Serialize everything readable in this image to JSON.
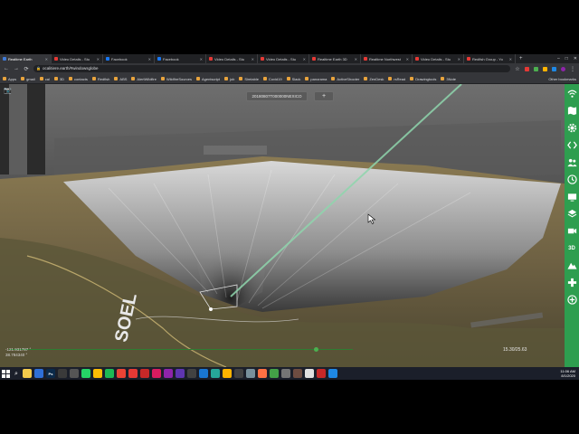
{
  "browser": {
    "tabs": [
      {
        "label": "Realtime Earth",
        "color": "#3f7ad6",
        "active": true
      },
      {
        "label": "Video Details - Stu",
        "color": "#e53935"
      },
      {
        "label": "Facebook",
        "color": "#1877f2"
      },
      {
        "label": "Facebook",
        "color": "#1877f2"
      },
      {
        "label": "Video Details - Stu",
        "color": "#e53935"
      },
      {
        "label": "Video Details - Stu",
        "color": "#e53935"
      },
      {
        "label": "Realtime Earth 3D",
        "color": "#e53935"
      },
      {
        "label": "Realtime Northwest",
        "color": "#e53935"
      },
      {
        "label": "Video Details - Stu",
        "color": "#e53935"
      },
      {
        "label": "Redfish Group - Yo",
        "color": "#e53935"
      }
    ],
    "new_tab_label": "+",
    "url": "ocalitiere.earth/#windowsglobe",
    "bookmarks": [
      "Apps",
      "gmail",
      "cal",
      "3D",
      "contacts",
      "Redfish",
      "ABS",
      "AlertWildfire",
      "WildfireSources",
      "Agentscript",
      "job",
      "Simtable",
      "Covid19",
      "Slack",
      "panorama",
      "ActiveShooter",
      "ZenDesk",
      "rsRead",
      "Drawingtools",
      "3Note"
    ],
    "other_bookmarks": "Other bookmarks"
  },
  "viewer": {
    "time_label": "20180807T000000NEXICO",
    "add_label": "+",
    "coords": {
      "lat": "-121.931787 °",
      "lon": "38.784340 °"
    },
    "view_readout": "15.30/25.63",
    "road_label": "SOEL"
  },
  "toolbar": {
    "items": [
      "wifi-icon",
      "map-icon",
      "gear-icon",
      "code-icon",
      "users-icon",
      "clock-icon",
      "tv-icon",
      "layers-icon",
      "video-icon",
      "3d-icon",
      "mountain-icon",
      "gamepad-icon",
      "plus-circle-icon"
    ],
    "label_3d": "3D",
    "color": "#2e9e4f"
  },
  "taskbar": {
    "apps": [
      {
        "name": "file-explorer-icon",
        "color": "#f2c94c",
        "glyph": ""
      },
      {
        "name": "mail-icon",
        "color": "#2f6fd6",
        "glyph": ""
      },
      {
        "name": "photoshop-icon",
        "color": "#0b2a4a",
        "glyph": "Ps"
      },
      {
        "name": "files-icon",
        "color": "#3a3a3a",
        "glyph": ""
      },
      {
        "name": "settings-icon",
        "color": "#555",
        "glyph": ""
      },
      {
        "name": "whatsapp-icon",
        "color": "#25d366",
        "glyph": ""
      },
      {
        "name": "chrome-icon",
        "color": "#fbbc05",
        "glyph": ""
      },
      {
        "name": "spotify-icon",
        "color": "#1db954",
        "glyph": ""
      },
      {
        "name": "chrome-icon-2",
        "color": "#ea4335",
        "glyph": ""
      },
      {
        "name": "youtube-icon",
        "color": "#e53935",
        "glyph": ""
      },
      {
        "name": "app-icon-1",
        "color": "#c62828",
        "glyph": ""
      },
      {
        "name": "app-icon-2",
        "color": "#d81b60",
        "glyph": ""
      },
      {
        "name": "app-icon-3",
        "color": "#8e24aa",
        "glyph": ""
      },
      {
        "name": "app-icon-4",
        "color": "#5e35b1",
        "glyph": ""
      },
      {
        "name": "app-icon-5",
        "color": "#424242",
        "glyph": ""
      },
      {
        "name": "vscode-icon",
        "color": "#1976d2",
        "glyph": ""
      },
      {
        "name": "app-icon-6",
        "color": "#26a69a",
        "glyph": ""
      },
      {
        "name": "app-icon-7",
        "color": "#ffb300",
        "glyph": ""
      },
      {
        "name": "app-icon-8",
        "color": "#424242",
        "glyph": ""
      },
      {
        "name": "app-icon-9",
        "color": "#78909c",
        "glyph": ""
      },
      {
        "name": "firefox-icon",
        "color": "#ff7043",
        "glyph": ""
      },
      {
        "name": "app-icon-10",
        "color": "#43a047",
        "glyph": ""
      },
      {
        "name": "app-icon-11",
        "color": "#757575",
        "glyph": ""
      },
      {
        "name": "app-icon-12",
        "color": "#6d4c41",
        "glyph": ""
      },
      {
        "name": "app-icon-13",
        "color": "#e0e0e0",
        "glyph": ""
      },
      {
        "name": "acrobat-icon",
        "color": "#c62828",
        "glyph": ""
      },
      {
        "name": "app-icon-14",
        "color": "#1e88e5",
        "glyph": ""
      }
    ],
    "time": "11:06 AM",
    "date": "8/1/2020"
  }
}
